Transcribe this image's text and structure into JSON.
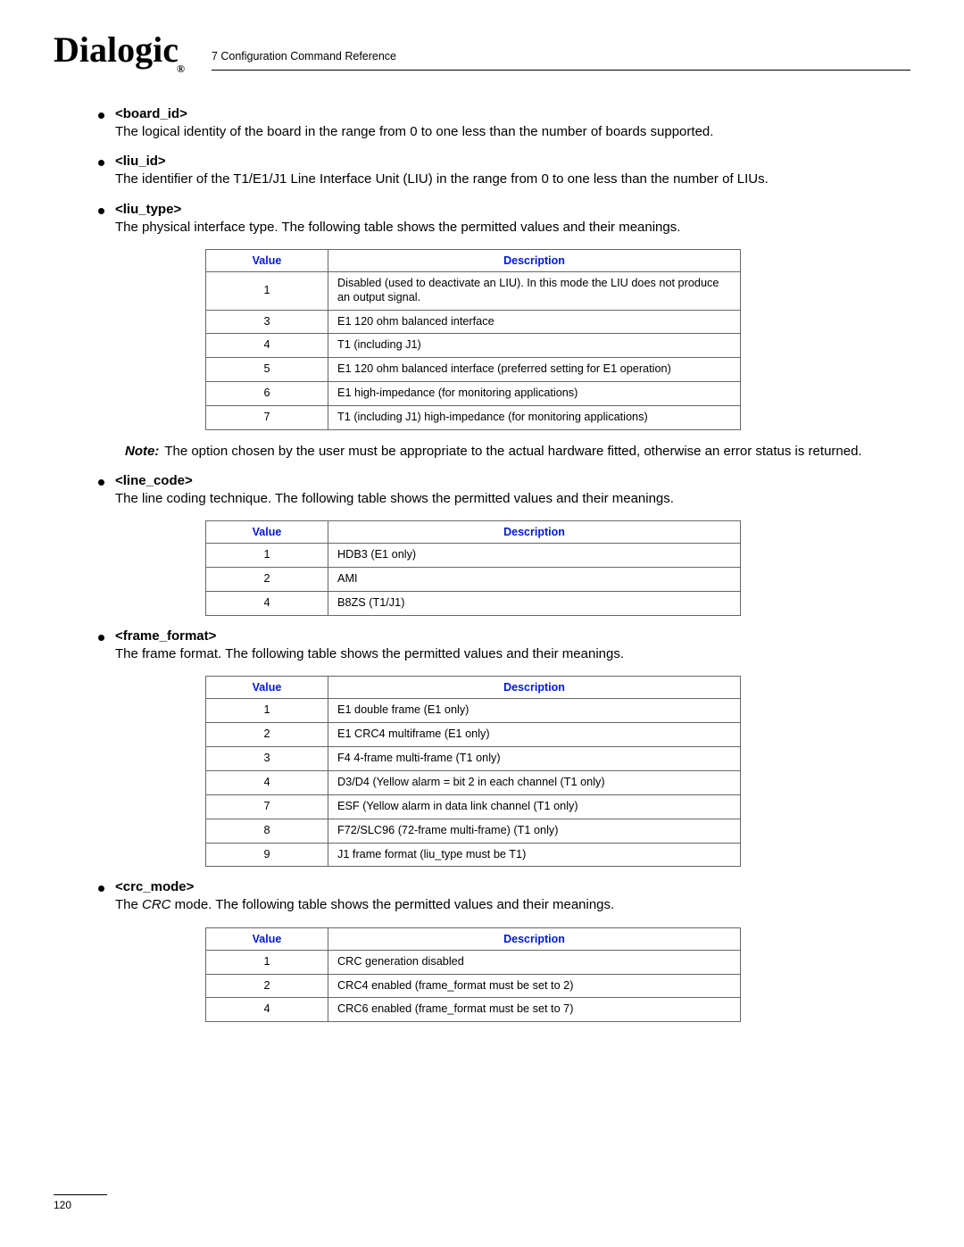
{
  "brand": {
    "name": "Dialogic",
    "reg": "®"
  },
  "chapter": "7 Configuration Command Reference",
  "page_number": "120",
  "table_headers": {
    "value": "Value",
    "description": "Description"
  },
  "note": {
    "label": "Note:",
    "text": "The option chosen by the user must be appropriate to the actual hardware fitted, otherwise an error status is returned."
  },
  "params": {
    "board_id": {
      "title": "<board_id>",
      "text": "The logical identity of the board in the range from 0 to one less than the number of boards supported."
    },
    "liu_id": {
      "title": "<liu_id>",
      "text": "The identifier of the T1/E1/J1 Line Interface Unit (LIU) in the range from 0 to one less than the number of LIUs."
    },
    "liu_type": {
      "title": "<liu_type>",
      "text": "The physical interface type. The following table shows the permitted values and their meanings.",
      "rows": [
        {
          "v": "1",
          "d": "Disabled (used to deactivate an LIU). In this mode the LIU does not produce an output signal."
        },
        {
          "v": "3",
          "d": "E1 120 ohm balanced interface"
        },
        {
          "v": "4",
          "d": "T1 (including J1)"
        },
        {
          "v": "5",
          "d": "E1 120 ohm balanced interface (preferred setting for E1 operation)"
        },
        {
          "v": "6",
          "d": "E1 high-impedance (for monitoring applications)"
        },
        {
          "v": "7",
          "d": "T1 (including J1) high-impedance (for monitoring applications)"
        }
      ]
    },
    "line_code": {
      "title": "<line_code>",
      "text": "The line coding technique. The following table shows the permitted values and their meanings.",
      "rows": [
        {
          "v": "1",
          "d": "HDB3 (E1 only)"
        },
        {
          "v": "2",
          "d": "AMI"
        },
        {
          "v": "4",
          "d": "B8ZS (T1/J1)"
        }
      ]
    },
    "frame_format": {
      "title": "<frame_format>",
      "text": "The frame format. The following table shows the permitted values and their meanings.",
      "rows": [
        {
          "v": "1",
          "d": "E1 double frame (E1 only)"
        },
        {
          "v": "2",
          "d": "E1 CRC4 multiframe (E1 only)"
        },
        {
          "v": "3",
          "d": "F4 4-frame multi-frame (T1 only)"
        },
        {
          "v": "4",
          "d": "D3/D4 (Yellow alarm = bit 2 in each channel (T1 only)"
        },
        {
          "v": "7",
          "d": "ESF (Yellow alarm in data link channel (T1 only)"
        },
        {
          "v": "8",
          "d": "F72/SLC96 (72-frame multi-frame) (T1 only)"
        },
        {
          "v": "9",
          "d": "J1 frame format (liu_type must be T1)"
        }
      ]
    },
    "crc_mode": {
      "title": "<crc_mode>",
      "text_prefix": "The ",
      "text_italic": "CRC",
      "text_suffix": " mode. The following table shows the permitted values and their meanings.",
      "rows": [
        {
          "v": "1",
          "d": "CRC generation disabled"
        },
        {
          "v": "2",
          "d": "CRC4 enabled (frame_format must be set to 2)"
        },
        {
          "v": "4",
          "d": "CRC6 enabled (frame_format must be set to 7)"
        }
      ]
    }
  }
}
